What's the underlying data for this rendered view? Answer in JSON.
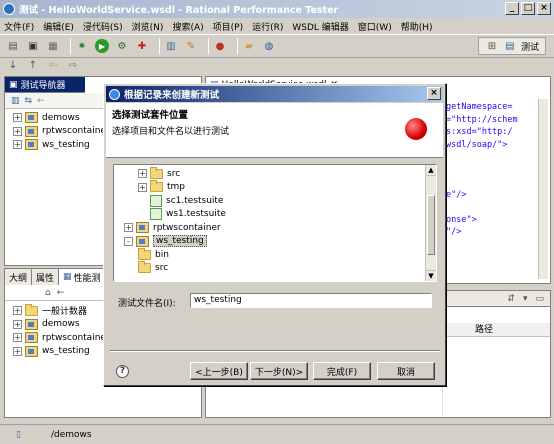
{
  "window": {
    "title": "测试 - HelloWorldService.wsdl - Rational Performance Tester",
    "buttons": [
      "_",
      "□",
      "×"
    ]
  },
  "menu": [
    "文件(F)",
    "编辑(E)",
    "浸代码(S)",
    "浏览(N)",
    "搜索(A)",
    "项目(P)",
    "运行(R)",
    "WSDL 编辑器",
    "窗口(W)",
    "帮助(H)"
  ],
  "perspective": {
    "label": "测试"
  },
  "test_navigator": {
    "tab_label": "测试导航器",
    "items": [
      {
        "label": "demows",
        "expanded": false
      },
      {
        "label": "rptwscontainer",
        "expanded": false
      },
      {
        "label": "ws_testing",
        "expanded": false
      }
    ]
  },
  "editor": {
    "tab_label": "HelloWorldService.wsdl",
    "lines": [
      "getNamespace=",
      "=\"http://schem",
      "s:xsd=\"http:/",
      "wsdl/soap/\">",
      "",
      "",
      "",
      "e\"/>",
      "",
      "onse\">",
      "\"/>"
    ]
  },
  "perf_panel": {
    "tabs": [
      "大纲",
      "属性",
      "性能测"
    ],
    "items": [
      {
        "label": "一般计数器"
      },
      {
        "label": "demows"
      },
      {
        "label": "rptwscontainer"
      },
      {
        "label": "ws_testing"
      }
    ]
  },
  "problems_panel": {
    "column": "路径"
  },
  "dialog": {
    "title": "根据记录来创建新测试",
    "heading": "选择测试套件位置",
    "description": "选择项目和文件名以进行测试",
    "tree": [
      {
        "label": "src",
        "type": "folder",
        "indent": 1,
        "toggle": "+"
      },
      {
        "label": "tmp",
        "type": "folder",
        "indent": 1,
        "toggle": "+"
      },
      {
        "label": "sc1.testsuite",
        "type": "suite",
        "indent": 2,
        "toggle": ""
      },
      {
        "label": "ws1.testsuite",
        "type": "suite",
        "indent": 2,
        "toggle": ""
      },
      {
        "label": "rptwscontainer",
        "type": "project",
        "indent": 0,
        "toggle": "+"
      },
      {
        "label": "ws_testing",
        "type": "project",
        "indent": 0,
        "toggle": "-",
        "selected": true
      },
      {
        "label": "bin",
        "type": "folder",
        "indent": 1,
        "toggle": ""
      },
      {
        "label": "src",
        "type": "folder",
        "indent": 1,
        "toggle": ""
      }
    ],
    "filename_label": "测试文件名(I):",
    "filename_value": "ws_testing",
    "buttons": {
      "back": "<上一步(B)",
      "next": "下一步(N)>",
      "finish": "完成(F)",
      "cancel": "取消"
    },
    "help_icon": "?"
  },
  "statusbar": {
    "path": "/demows"
  },
  "colors": {
    "selection": "#0a246a",
    "dialog_title": "#0a246a",
    "error_icon": "#d40000"
  }
}
